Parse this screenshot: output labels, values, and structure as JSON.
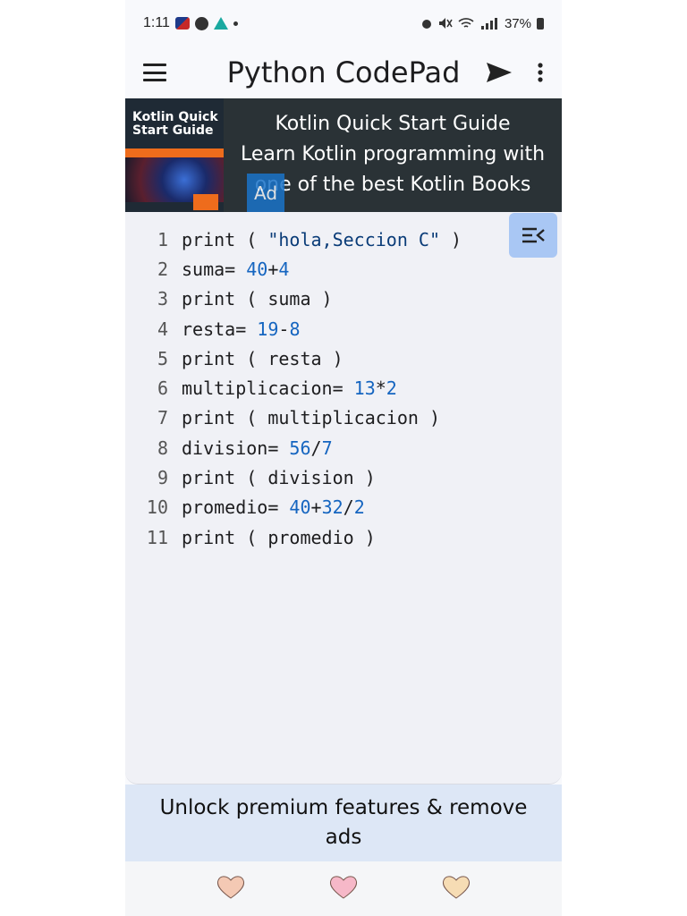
{
  "status_bar": {
    "time": "1:11",
    "battery": "37%"
  },
  "app_bar": {
    "title": "Python CodePad"
  },
  "ad": {
    "book_title": "Kotlin Quick Start Guide",
    "line1": "Kotlin Quick Start Guide",
    "line2": "Learn Kotlin programming with",
    "line3": "one of the best Kotlin Books",
    "label": "Ad"
  },
  "editor": {
    "lines": [
      {
        "n": "1",
        "tokens": [
          [
            "kw",
            "print ( "
          ],
          [
            "str",
            "\"hola,Seccion C\""
          ],
          [
            "op",
            " )"
          ]
        ]
      },
      {
        "n": "2",
        "tokens": [
          [
            "kw",
            "suma= "
          ],
          [
            "num",
            "40"
          ],
          [
            "op",
            "+"
          ],
          [
            "num",
            "4"
          ]
        ]
      },
      {
        "n": "3",
        "tokens": [
          [
            "kw",
            "print ( suma )"
          ]
        ]
      },
      {
        "n": "4",
        "tokens": [
          [
            "kw",
            "resta= "
          ],
          [
            "num",
            "19"
          ],
          [
            "op",
            "-"
          ],
          [
            "num",
            "8"
          ]
        ]
      },
      {
        "n": "5",
        "tokens": [
          [
            "kw",
            "print ( resta )"
          ]
        ]
      },
      {
        "n": "6",
        "tokens": [
          [
            "kw",
            "multiplicacion= "
          ],
          [
            "num",
            "13"
          ],
          [
            "op",
            "*"
          ],
          [
            "num",
            "2"
          ]
        ]
      },
      {
        "n": "7",
        "tokens": [
          [
            "kw",
            "print ( multiplicacion )"
          ]
        ]
      },
      {
        "n": "8",
        "tokens": [
          [
            "kw",
            "division= "
          ],
          [
            "num",
            "56"
          ],
          [
            "op",
            "/"
          ],
          [
            "num",
            "7"
          ]
        ]
      },
      {
        "n": "9",
        "tokens": [
          [
            "kw",
            "print ( division )"
          ]
        ]
      },
      {
        "n": "10",
        "tokens": [
          [
            "kw",
            "promedio= "
          ],
          [
            "num",
            "40"
          ],
          [
            "op",
            "+"
          ],
          [
            "num",
            "32"
          ],
          [
            "op",
            "/"
          ],
          [
            "num",
            "2"
          ]
        ]
      },
      {
        "n": "11",
        "tokens": [
          [
            "kw",
            "print ( promedio )"
          ]
        ]
      }
    ]
  },
  "premium": {
    "text": "Unlock premium features & remove ads"
  },
  "bottom_nav": {
    "items": [
      {
        "icon": "heart-icon",
        "color": "#f4c9b4"
      },
      {
        "icon": "heart-icon",
        "color": "#f6b8c8"
      },
      {
        "icon": "heart-icon",
        "color": "#f6dcb4"
      }
    ]
  },
  "colors": {
    "accent": "#a9c7f4",
    "premium_bg": "#dde7f6",
    "ad_bg": "#2a3236"
  }
}
